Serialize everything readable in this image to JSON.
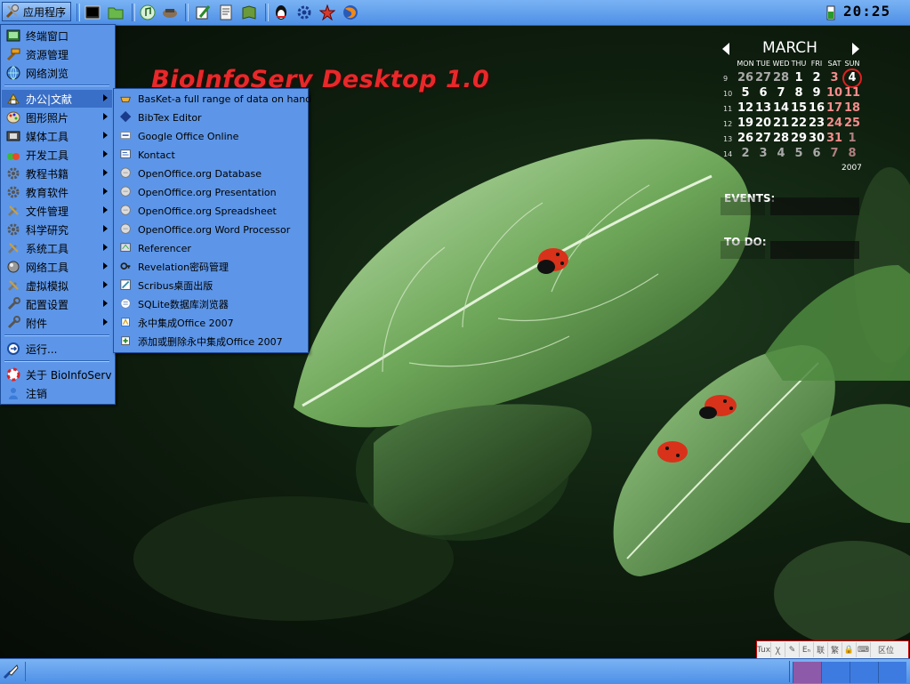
{
  "desktop": {
    "title": "BioInfoServ Desktop 1.0"
  },
  "top_panel": {
    "app_menu_label": "应用程序",
    "launchers": [
      "terminal-icon",
      "file-manager-icon",
      "music-icon",
      "network-icon",
      "edit-icon",
      "document-icon",
      "book-icon",
      "qq-icon",
      "settings-icon",
      "system-icon",
      "firefox-icon"
    ],
    "clock": "20:25"
  },
  "main_menu": {
    "items": [
      {
        "label": "终端窗口",
        "submenu": false
      },
      {
        "label": "资源管理",
        "submenu": false
      },
      {
        "label": "网络浏览",
        "submenu": false
      },
      {
        "label": "办公|文献",
        "submenu": true
      },
      {
        "label": "图形照片",
        "submenu": true
      },
      {
        "label": "媒体工具",
        "submenu": true
      },
      {
        "label": "开发工具",
        "submenu": true
      },
      {
        "label": "教程书籍",
        "submenu": true
      },
      {
        "label": "教育软件",
        "submenu": true
      },
      {
        "label": "文件管理",
        "submenu": true
      },
      {
        "label": "科学研究",
        "submenu": true
      },
      {
        "label": "系统工具",
        "submenu": true
      },
      {
        "label": "网络工具",
        "submenu": true
      },
      {
        "label": "虚拟模拟",
        "submenu": true
      },
      {
        "label": "配置设置",
        "submenu": true
      },
      {
        "label": "附件",
        "submenu": true
      },
      {
        "label": "运行...",
        "submenu": false
      },
      {
        "label": "关于 BioInfoServ",
        "submenu": false
      },
      {
        "label": "注销",
        "submenu": false
      }
    ]
  },
  "sub_menu": {
    "items": [
      "BasKet-a full range of data on hand",
      "BibTex Editor",
      "Google Office Online",
      "Kontact",
      "OpenOffice.org Database",
      "OpenOffice.org Presentation",
      "OpenOffice.org Spreadsheet",
      "OpenOffice.org Word Processor",
      "Referencer",
      "Revelation密码管理",
      "Scribus桌面出版",
      "SQLite数据库浏览器",
      "永中集成Office 2007",
      "添加或删除永中集成Office 2007"
    ]
  },
  "calendar": {
    "month": "MARCH",
    "year": "2007",
    "weekdays": [
      "MON",
      "TUE",
      "WED",
      "THU",
      "FRI",
      "SAT",
      "SUN"
    ],
    "weeks": [
      {
        "wk": "9",
        "days": [
          "26",
          "27",
          "28",
          "1",
          "2",
          "3",
          "4"
        ]
      },
      {
        "wk": "10",
        "days": [
          "5",
          "6",
          "7",
          "8",
          "9",
          "10",
          "11"
        ]
      },
      {
        "wk": "11",
        "days": [
          "12",
          "13",
          "14",
          "15",
          "16",
          "17",
          "18"
        ]
      },
      {
        "wk": "12",
        "days": [
          "19",
          "20",
          "21",
          "22",
          "23",
          "24",
          "25"
        ]
      },
      {
        "wk": "13",
        "days": [
          "26",
          "27",
          "28",
          "29",
          "30",
          "31",
          "1"
        ]
      },
      {
        "wk": "14",
        "days": [
          "2",
          "3",
          "4",
          "5",
          "6",
          "7",
          "8"
        ]
      }
    ],
    "today": "4",
    "events_label": "EVENTS:",
    "todo_label": "TO DO:"
  },
  "tray": {
    "ime": [
      "Tux",
      "Ꭓ",
      "✎",
      "Eₙ",
      "联",
      "繁",
      "🔒",
      "⌨",
      "区位"
    ]
  },
  "colors": {
    "panel": "#5b9bef",
    "menu": "#5d96e8",
    "weekend": "#f48c8c",
    "title": "#e8282a"
  }
}
